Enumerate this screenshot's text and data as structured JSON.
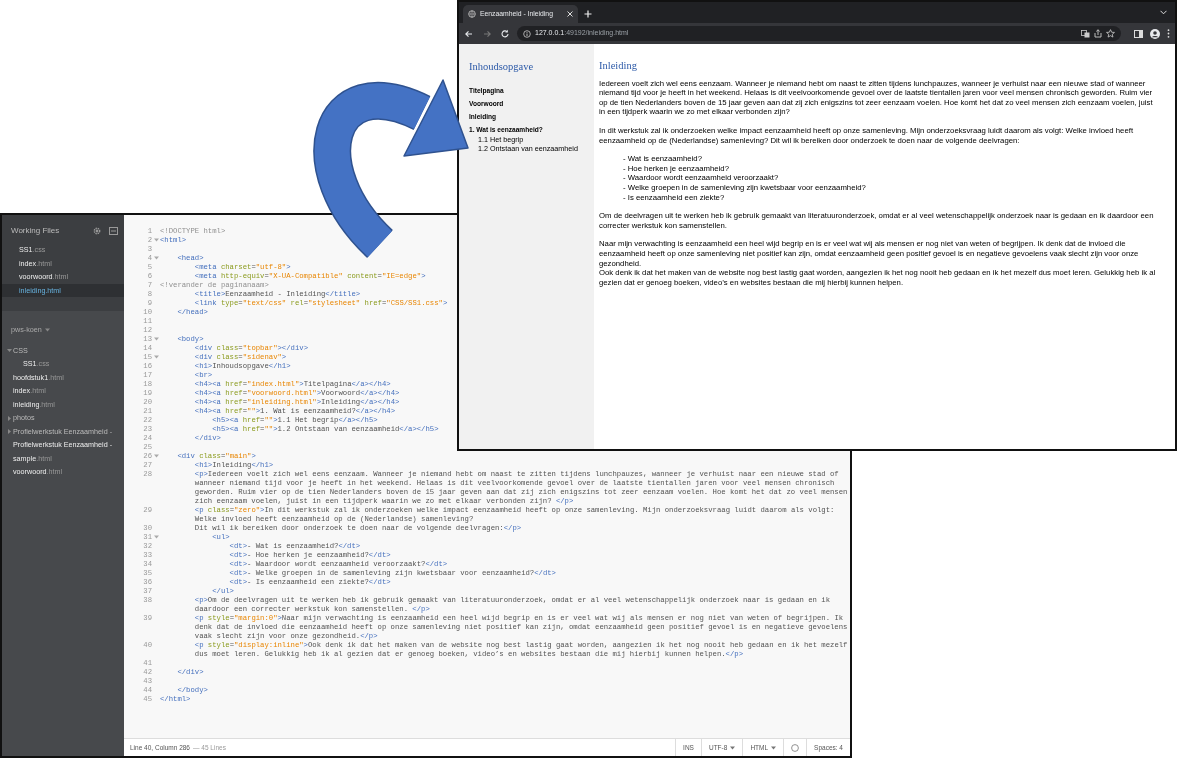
{
  "editor": {
    "sidebar": {
      "working_files_title": "Working Files",
      "working_files": [
        {
          "name": "SS1",
          "ext": ".css",
          "selected": false
        },
        {
          "name": "index",
          "ext": ".html",
          "selected": false
        },
        {
          "name": "voorwoord",
          "ext": ".html",
          "selected": false
        },
        {
          "name": "inleiding",
          "ext": ".html",
          "selected": true
        }
      ],
      "project": "pws-koen",
      "tree": [
        {
          "kind": "folder",
          "name": "CSS",
          "expanded": true,
          "children": [
            {
              "kind": "file",
              "name": "SS1",
              "ext": ".css"
            }
          ]
        },
        {
          "kind": "file",
          "name": "hoofdstuk1",
          "ext": ".html"
        },
        {
          "kind": "file",
          "name": "index",
          "ext": ".html"
        },
        {
          "kind": "file",
          "name": "inleiding",
          "ext": ".html"
        },
        {
          "kind": "folder",
          "name": "photos",
          "expanded": false
        },
        {
          "kind": "folder",
          "name": "Profielwerkstuk Eenzaamheid -",
          "expanded": false
        },
        {
          "kind": "file",
          "name": "Profielwerkstuk Eenzaamheid -"
        },
        {
          "kind": "file",
          "name": "sample",
          "ext": ".html"
        },
        {
          "kind": "file",
          "name": "voorwoord",
          "ext": ".html"
        }
      ]
    },
    "code_lines": [
      {
        "n": "1",
        "text": "<!DOCTYPE html>",
        "foldable": false
      },
      {
        "n": "2",
        "text": "<html>",
        "foldable": true
      },
      {
        "n": "3",
        "foldable": false
      },
      {
        "n": "4",
        "text": "    <head>",
        "foldable": true
      },
      {
        "n": "5",
        "text": "        <meta charset=\"utf-8\">",
        "foldable": false
      },
      {
        "n": "6",
        "text": "        <meta http-equiv=\"X-UA-Compatible\" content=\"IE=edge\">",
        "foldable": false
      },
      {
        "n": "7",
        "text": "<!verander de paginanaam>",
        "foldable": false
      },
      {
        "n": "8",
        "text": "        <title>Eenzaamheid - Inleiding</title>",
        "foldable": false
      },
      {
        "n": "9",
        "text": "        <link type=\"text/css\" rel=\"stylesheet\" href=\"CSS/SS1.css\">",
        "foldable": false
      },
      {
        "n": "10",
        "text": "    </head>",
        "foldable": false
      },
      {
        "n": "11",
        "foldable": false
      },
      {
        "n": "12",
        "foldable": false
      },
      {
        "n": "13",
        "text": "    <body>",
        "foldable": true
      },
      {
        "n": "14",
        "text": "        <div class=\"topbar\"></div>",
        "foldable": false
      },
      {
        "n": "15",
        "text": "        <div class=\"sidenav\">",
        "foldable": true
      },
      {
        "n": "16",
        "text": "        <h1>Inhoudsopgave</h1>",
        "foldable": false
      },
      {
        "n": "17",
        "text": "        <br>",
        "foldable": false
      },
      {
        "n": "18",
        "text": "        <h4><a href=\"index.html\">Titelpagina</a></h4>",
        "foldable": false
      },
      {
        "n": "19",
        "text": "        <h4><a href=\"voorwoord.html\">Voorwoord</a></h4>",
        "foldable": false
      },
      {
        "n": "20",
        "text": "        <h4><a href=\"inleiding.html\">Inleiding</a></h4>",
        "foldable": false
      },
      {
        "n": "21",
        "text": "        <h4><a href=\"\">1. Wat is eenzaamheid?</a></h4>",
        "foldable": false
      },
      {
        "n": "22",
        "text": "            <h5><a href=\"\">1.1 Het begrip</a></h5>",
        "foldable": false
      },
      {
        "n": "23",
        "text": "            <h5><a href=\"\">1.2 Ontstaan van eenzaamheid</a></h5>",
        "foldable": false
      },
      {
        "n": "24",
        "text": "        </div>",
        "foldable": false
      },
      {
        "n": "25",
        "foldable": false
      },
      {
        "n": "26",
        "text": "    <div class=\"main\">",
        "foldable": true
      },
      {
        "n": "27",
        "text": "        <h1>Inleiding</h1>",
        "foldable": false
      },
      {
        "n": "28",
        "text": "        <p>Iedereen voelt zich wel eens eenzaam. Wanneer je niemand hebt om naast te zitten tijdens lunchpauzes, wanneer je verhuist naar een nieuwe stad of wanneer niemand tijd voor je heeft in het weekend. Helaas is dit veelvoorkomende gevoel over de laatste tientallen jaren voor veel mensen chronisch geworden. Ruim vier op de tien Nederlanders boven de 15 jaar geven aan dat zij zich enigszins tot zeer eenzaam voelen. Hoe komt het dat zo veel mensen zich eenzaam voelen, juist in een tijdperk waarin we zo met elkaar verbonden zijn? </p>",
        "foldable": false
      },
      {
        "n": "29",
        "text": "        <p class=\"zero\">In dit werkstuk zal ik onderzoeken welke impact eenzaamheid heeft op onze samenleving. Mijn onderzoeksvraag luidt daarom als volgt: Welke invloed heeft eenzaamheid op de (Nederlandse) samenleving?",
        "foldable": false
      },
      {
        "n": "30",
        "text": "        Dit wil ik bereiken door onderzoek te doen naar de volgende deelvragen:</p>",
        "foldable": false
      },
      {
        "n": "31",
        "text": "            <ul>",
        "foldable": true
      },
      {
        "n": "32",
        "text": "                <dt>- Wat is eenzaamheid?</dt>",
        "foldable": false
      },
      {
        "n": "33",
        "text": "                <dt>- Hoe herken je eenzaamheid?</dt>",
        "foldable": false
      },
      {
        "n": "34",
        "text": "                <dt>- Waardoor wordt eenzaamheid veroorzaakt?</dt>",
        "foldable": false
      },
      {
        "n": "35",
        "text": "                <dt>- Welke groepen in de samenleving zijn kwetsbaar voor eenzaamheid?</dt>",
        "foldable": false
      },
      {
        "n": "36",
        "text": "                <dt>- Is eenzaamheid een ziekte?</dt>",
        "foldable": false
      },
      {
        "n": "37",
        "text": "            </ul>",
        "foldable": false
      },
      {
        "n": "38",
        "text": "        <p>Om de deelvragen uit te werken heb ik gebruik gemaakt van literatuuronderzoek, omdat er al veel wetenschappelijk onderzoek naar is gedaan en ik daardoor een correcter werkstuk kon samenstellen. </p>",
        "foldable": false
      },
      {
        "n": "39",
        "text": "        <p style=\"margin:0\">Naar mijn verwachting is eenzaamheid een heel wijd begrip en is er veel wat wij als mensen er nog niet van weten of begrijpen. Ik denk dat de invloed die eenzaamheid heeft op onze samenleving niet positief kan zijn, omdat eenzaamheid geen positief gevoel is en negatieve gevoelens vaak slecht zijn voor onze gezondheid.</p>",
        "foldable": false
      },
      {
        "n": "40",
        "text": "        <p style=\"display:inline\">Ook denk ik dat het maken van de website nog best lastig gaat worden, aangezien ik het nog nooit heb gedaan en ik het mezelf dus moet leren. Gelukkig heb ik al gezien dat er genoeg boeken, video’s en websites bestaan die mij hierbij kunnen helpen.</p>",
        "foldable": false
      },
      {
        "n": "41",
        "foldable": false
      },
      {
        "n": "42",
        "text": "    </div>",
        "foldable": false
      },
      {
        "n": "43",
        "foldable": false
      },
      {
        "n": "44",
        "text": "    </body>",
        "foldable": false
      },
      {
        "n": "45",
        "text": "</html>",
        "foldable": false
      }
    ],
    "status_bar": {
      "position": "Line 40, Column 286",
      "line_count": "— 45 Lines",
      "mode": "INS",
      "encoding": "UTF-8",
      "language": "HTML",
      "spaces": "Spaces: 4"
    }
  },
  "browser": {
    "tab": {
      "title": "Eenzaamheid - Inleiding"
    },
    "nav_buttons": [
      {
        "kind": "back",
        "disabled": false
      },
      {
        "kind": "forward",
        "disabled": true
      },
      {
        "kind": "reload",
        "disabled": false
      }
    ],
    "url_host": "127.0.0.1",
    "url_path": ":49192/inleiding.html",
    "page": {
      "sidebar_title": "Inhoudsopgave",
      "nav": [
        {
          "label": "Titelpagina"
        },
        {
          "label": "Voorwoord"
        },
        {
          "label": "Inleiding"
        },
        {
          "label": "1. Wat is eenzaamheid?",
          "children": [
            {
              "label": "1.1 Het begrip"
            },
            {
              "label": "1.2 Ontstaan van eenzaamheid"
            }
          ]
        }
      ],
      "heading": "Inleiding",
      "blocks": [
        {
          "kind": "paragraph",
          "text": "Iedereen voelt zich wel eens eenzaam. Wanneer je niemand hebt om naast te zitten tijdens lunchpauzes, wanneer je verhuist naar een nieuwe stad of wanneer niemand tijd voor je heeft in het weekend. Helaas is dit veelvoorkomende gevoel over de laatste tientallen jaren voor veel mensen chronisch geworden. Ruim vier op de tien Nederlanders boven de 15 jaar geven aan dat zij zich enigszins tot zeer eenzaam voelen. Hoe komt het dat zo veel mensen zich eenzaam voelen, juist in een tijdperk waarin we zo met elkaar verbonden zijn?"
        },
        {
          "kind": "paragraph",
          "text": "In dit werkstuk zal ik onderzoeken welke impact eenzaamheid heeft op onze samenleving. Mijn onderzoeksvraag luidt daarom als volgt: Welke invloed heeft eenzaamheid op de (Nederlandse) samenleving? Dit wil ik bereiken door onderzoek te doen naar de volgende deelvragen:"
        },
        {
          "kind": "list",
          "items": [
            "- Wat is eenzaamheid?",
            "- Hoe herken je eenzaamheid?",
            "- Waardoor wordt eenzaamheid veroorzaakt?",
            "- Welke groepen in de samenleving zijn kwetsbaar voor eenzaamheid?",
            "- Is eenzaamheid een ziekte?"
          ]
        },
        {
          "kind": "paragraph",
          "text": "Om de deelvragen uit te werken heb ik gebruik gemaakt van literatuuronderzoek, omdat er al veel wetenschappelijk onderzoek naar is gedaan en ik daardoor een correcter werkstuk kon samenstellen."
        },
        {
          "kind": "tight_paragraph",
          "text": "Naar mijn verwachting is eenzaamheid een heel wijd begrip en is er veel wat wij als mensen er nog niet van weten of begrijpen. Ik denk dat de invloed die eenzaamheid heeft op onze samenleving niet positief kan zijn, omdat eenzaamheid geen positief gevoel is en negatieve gevoelens vaak slecht zijn voor onze gezondheid."
        },
        {
          "kind": "paragraph",
          "text": "Ook denk ik dat het maken van de website nog best lastig gaat worden, aangezien ik het nog nooit heb gedaan en ik het mezelf dus moet leren. Gelukkig heb ik al gezien dat er genoeg boeken, video’s en websites bestaan die mij hierbij kunnen helpen."
        }
      ]
    }
  }
}
